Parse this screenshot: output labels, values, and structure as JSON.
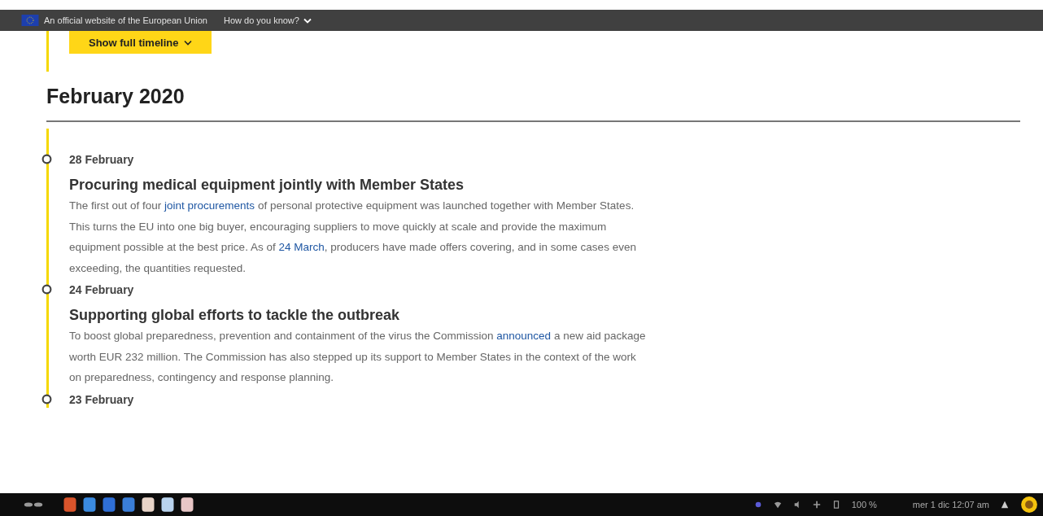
{
  "eu_bar": {
    "text": "An official website of the European Union",
    "link": "How do you know?"
  },
  "timeline_button": {
    "label": "Show full timeline"
  },
  "month": {
    "title": "February 2020"
  },
  "entries": [
    {
      "date": "28 February",
      "title": "Procuring medical equipment jointly with Member States",
      "body": [
        {
          "kind": "text",
          "text": "The first out of four "
        },
        {
          "kind": "link",
          "text": "joint procurements"
        },
        {
          "kind": "text",
          "text": " of personal protective equipment was launched together with Member States. This turns the EU into one big buyer, encouraging suppliers to move quickly at scale and provide the maximum equipment possible at the best price. As of "
        },
        {
          "kind": "link",
          "text": "24 March"
        },
        {
          "kind": "text",
          "text": ", producers have made offers covering, and in some cases even exceeding, the quantities requested."
        }
      ]
    },
    {
      "date": "24 February",
      "title": "Supporting global efforts to tackle the outbreak",
      "body": [
        {
          "kind": "text",
          "text": "To boost global preparedness, prevention and containment of the virus the Commission "
        },
        {
          "kind": "link",
          "text": "announced"
        },
        {
          "kind": "text",
          "text": " a new aid package worth EUR 232 million. The Commission has also stepped up its support to Member States in the context of the work on preparedness, contingency and response planning."
        }
      ]
    },
    {
      "date": "23 February"
    }
  ],
  "taskbar": {
    "battery": "100 %",
    "clock": "mer 1 dic  12:07 am"
  }
}
